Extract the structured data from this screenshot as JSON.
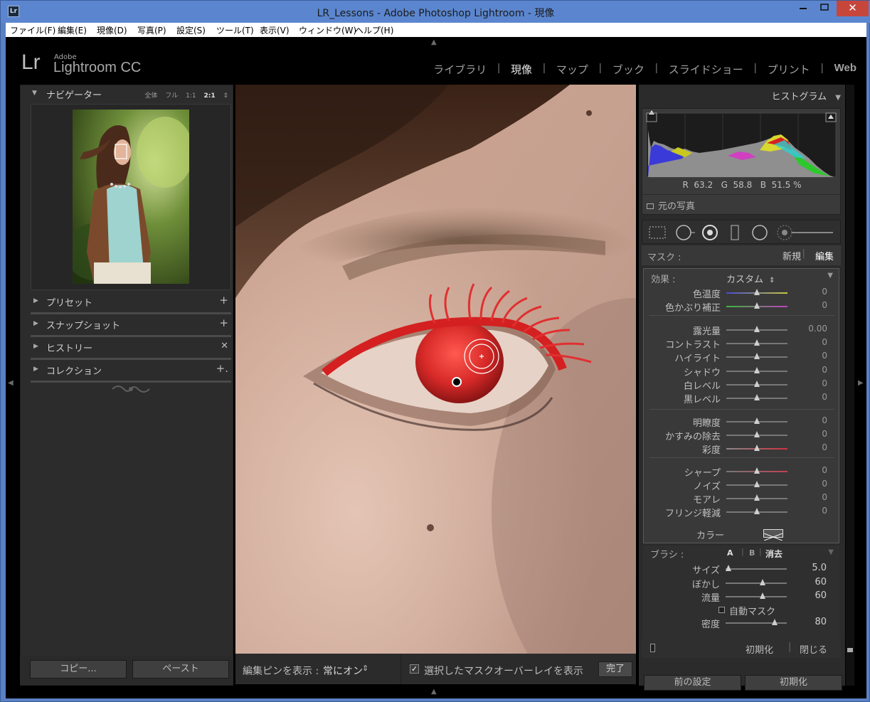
{
  "window": {
    "title": "LR_Lessons - Adobe Photoshop Lightroom - 現像",
    "app_icon": "Lr",
    "minimize": "▭",
    "close": "✕"
  },
  "menu": [
    "ファイル(F)",
    "編集(E)",
    "現像(D)",
    "写真(P)",
    "設定(S)",
    "ツール(T)",
    "表示(V)",
    "ウィンドウ(W)",
    "ヘルプ(H)"
  ],
  "logo": {
    "mark": "Lr",
    "adobe": "Adobe",
    "name": "Lightroom CC"
  },
  "modules": [
    {
      "label": "ライブラリ",
      "active": false
    },
    {
      "label": "現像",
      "active": true
    },
    {
      "label": "マップ",
      "active": false
    },
    {
      "label": "ブック",
      "active": false
    },
    {
      "label": "スライドショー",
      "active": false
    },
    {
      "label": "プリント",
      "active": false
    },
    {
      "label": "Web",
      "active": false
    }
  ],
  "navigator": {
    "title": "ナビゲーター",
    "zoom": [
      "全体",
      "フル",
      "1:1",
      "2:1"
    ],
    "zoom_selected": "2:1",
    "zoom_menu": "⇕"
  },
  "left_sections": [
    {
      "label": "プリセット",
      "action": "+"
    },
    {
      "label": "スナップショット",
      "action": "+"
    },
    {
      "label": "ヒストリー",
      "action": "✕"
    },
    {
      "label": "コレクション",
      "action": "+."
    }
  ],
  "left_buttons": {
    "copy": "コピー...",
    "paste": "ペースト"
  },
  "toolbar": {
    "pins_label": "編集ピンを表示 :",
    "pins_value": "常にオン",
    "pins_arrow": "⇕",
    "overlay_label": "選択したマスクオーバーレイを表示",
    "overlay_checked": true,
    "done": "完了"
  },
  "histogram": {
    "title": "ヒストグラム",
    "r_label": "R",
    "r_value": "63.2",
    "g_label": "G",
    "g_value": "58.8",
    "b_label": "B",
    "b_value": "51.5",
    "unit": "%",
    "original_photo": "元の写真"
  },
  "mask": {
    "label": "マスク :",
    "new": "新規",
    "edit": "編集"
  },
  "effect": {
    "label": "効果 :",
    "value": "カスタム",
    "arrow": "⇕"
  },
  "sliders": [
    {
      "label": "色温度",
      "value": "0",
      "pos": 0.5
    },
    {
      "label": "色かぶり補正",
      "value": "0",
      "pos": 0.5
    },
    {
      "label": "露光量",
      "value": "0.00",
      "pos": 0.5
    },
    {
      "label": "コントラスト",
      "value": "0",
      "pos": 0.5
    },
    {
      "label": "ハイライト",
      "value": "0",
      "pos": 0.5
    },
    {
      "label": "シャドウ",
      "value": "0",
      "pos": 0.5
    },
    {
      "label": "白レベル",
      "value": "0",
      "pos": 0.5
    },
    {
      "label": "黒レベル",
      "value": "0",
      "pos": 0.5
    },
    {
      "label": "明瞭度",
      "value": "0",
      "pos": 0.5
    },
    {
      "label": "かすみの除去",
      "value": "0",
      "pos": 0.5
    },
    {
      "label": "彩度",
      "value": "0",
      "pos": 0.5
    },
    {
      "label": "シャープ",
      "value": "0",
      "pos": 0.5
    },
    {
      "label": "ノイズ",
      "value": "0",
      "pos": 0.5
    },
    {
      "label": "モアレ",
      "value": "0",
      "pos": 0.5
    },
    {
      "label": "フリンジ軽減",
      "value": "0",
      "pos": 0.5
    }
  ],
  "color": {
    "label": "カラー"
  },
  "brush": {
    "label": "ブラシ :",
    "a": "A",
    "b": "B",
    "erase": "消去",
    "sliders": [
      {
        "label": "サイズ",
        "value": "5.0",
        "pos": 0.05
      },
      {
        "label": "ぼかし",
        "value": "60",
        "pos": 0.6
      },
      {
        "label": "流量",
        "value": "60",
        "pos": 0.6
      }
    ],
    "automask": "自動マスク",
    "automask_checked": false,
    "density_label": "密度",
    "density_value": "80",
    "density_pos": 0.8
  },
  "panel_actions": {
    "reset": "初期化",
    "close": "閉じる"
  },
  "bottom_right": {
    "previous": "前の設定",
    "reset": "初期化"
  },
  "colors": {
    "accent_red": "#d0202a",
    "panel": "#2b2b2b"
  }
}
